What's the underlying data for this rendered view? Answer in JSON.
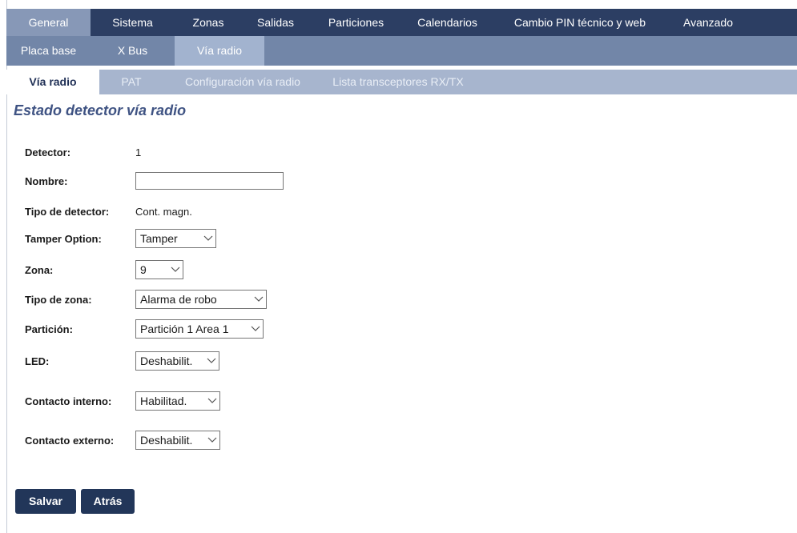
{
  "nav_level1": [
    {
      "label": "General",
      "active": true
    },
    {
      "label": "Sistema",
      "active": false
    },
    {
      "label": "Zonas",
      "active": false
    },
    {
      "label": "Salidas",
      "active": false
    },
    {
      "label": "Particiones",
      "active": false
    },
    {
      "label": "Calendarios",
      "active": false
    },
    {
      "label": "Cambio PIN técnico y web",
      "active": false
    },
    {
      "label": "Avanzado",
      "active": false
    }
  ],
  "nav_level2": [
    {
      "label": "Placa base",
      "active": false
    },
    {
      "label": "X Bus",
      "active": false
    },
    {
      "label": "Vía radio",
      "active": true
    }
  ],
  "nav_level3": [
    {
      "label": "Vía radio",
      "active": true
    },
    {
      "label": "PAT",
      "active": false
    },
    {
      "label": "Configuración vía radio",
      "active": false
    },
    {
      "label": "Lista transceptores RX/TX",
      "active": false
    }
  ],
  "page_title": "Estado detector vía radio",
  "form": {
    "detector": {
      "label": "Detector:",
      "value": "1"
    },
    "nombre": {
      "label": "Nombre:",
      "value": ""
    },
    "tipo_detector": {
      "label": "Tipo de detector:",
      "value": "Cont. magn."
    },
    "tamper_option": {
      "label": "Tamper Option:",
      "selected": "Tamper"
    },
    "zona": {
      "label": "Zona:",
      "selected": "9"
    },
    "tipo_zona": {
      "label": "Tipo de zona:",
      "selected": "Alarma de robo"
    },
    "particion": {
      "label": "Partición:",
      "selected": "Partición 1 Area 1"
    },
    "led": {
      "label": "LED:",
      "selected": "Deshabilit."
    },
    "contacto_interno": {
      "label": "Contacto interno:",
      "selected": "Habilitad."
    },
    "contacto_externo": {
      "label": "Contacto externo:",
      "selected": "Deshabilit."
    }
  },
  "buttons": {
    "save": "Salvar",
    "back": "Atrás"
  },
  "icons": {
    "dropdown": "chevron-down-icon"
  },
  "colors": {
    "nav1_bg": "#2c3e63",
    "nav2_bg": "#7286a8",
    "nav3_bg": "#a7b5ce",
    "title": "#3f5383",
    "button_bg": "#223659"
  }
}
